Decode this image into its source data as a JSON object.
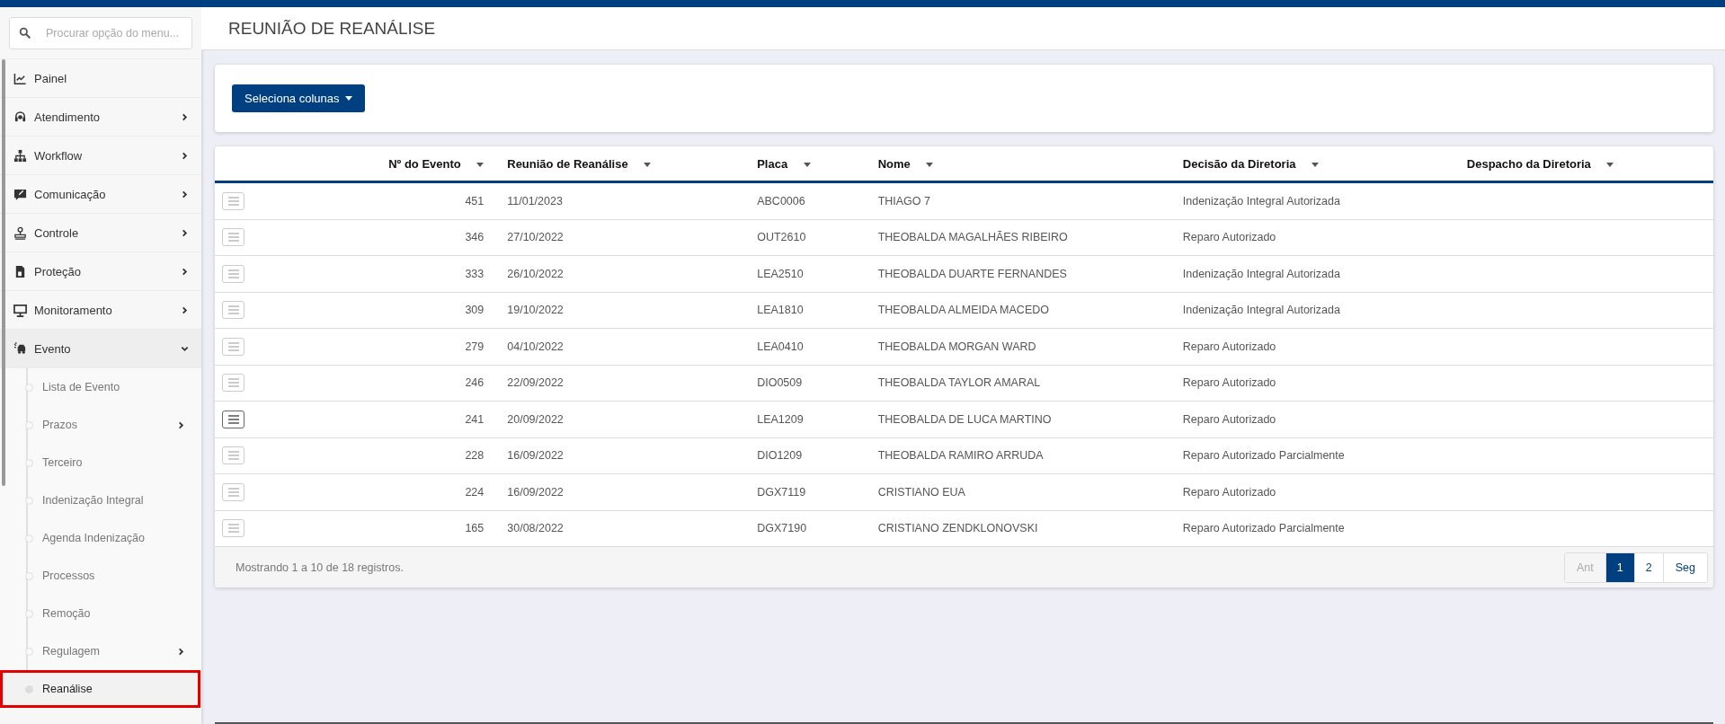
{
  "sidebar": {
    "search": {
      "placeholder": "Procurar opção do menu..."
    },
    "items": [
      {
        "label": "Painel",
        "has_submenu": false,
        "expanded": false
      },
      {
        "label": "Atendimento",
        "has_submenu": true,
        "expanded": false
      },
      {
        "label": "Workflow",
        "has_submenu": true,
        "expanded": false
      },
      {
        "label": "Comunicação",
        "has_submenu": true,
        "expanded": false
      },
      {
        "label": "Controle",
        "has_submenu": true,
        "expanded": false
      },
      {
        "label": "Proteção",
        "has_submenu": true,
        "expanded": false
      },
      {
        "label": "Monitoramento",
        "has_submenu": true,
        "expanded": false
      },
      {
        "label": "Evento",
        "has_submenu": true,
        "expanded": true,
        "children": [
          {
            "label": "Lista de Evento",
            "has_submenu": false,
            "selected": false
          },
          {
            "label": "Prazos",
            "has_submenu": true,
            "selected": false
          },
          {
            "label": "Terceiro",
            "has_submenu": false,
            "selected": false
          },
          {
            "label": "Indenização Integral",
            "has_submenu": false,
            "selected": false
          },
          {
            "label": "Agenda Indenização",
            "has_submenu": false,
            "selected": false
          },
          {
            "label": "Processos",
            "has_submenu": false,
            "selected": false
          },
          {
            "label": "Remoção",
            "has_submenu": false,
            "selected": false
          },
          {
            "label": "Regulagem",
            "has_submenu": true,
            "selected": false
          },
          {
            "label": "Reanálise",
            "has_submenu": false,
            "selected": true
          }
        ]
      }
    ]
  },
  "page": {
    "title": "REUNIÃO DE REANÁLISE"
  },
  "toolbar": {
    "button": "Seleciona colunas"
  },
  "table": {
    "columns": [
      "Nº do Evento",
      "Reunião de Reanálise",
      "Placa",
      "Nome",
      "Decisão da Diretoria",
      "Despacho da Diretoria"
    ],
    "rows": [
      {
        "cells": [
          "451",
          "11/01/2023",
          "ABC0006",
          "THIAGO 7",
          "Indenização Integral Autorizada"
        ],
        "hovered": false
      },
      {
        "cells": [
          "346",
          "27/10/2022",
          "OUT2610",
          "THEOBALDA MAGALHÃES RIBEIRO",
          "Reparo Autorizado"
        ],
        "hovered": false
      },
      {
        "cells": [
          "333",
          "26/10/2022",
          "LEA2510",
          "THEOBALDA DUARTE FERNANDES",
          "Indenização Integral Autorizada"
        ],
        "hovered": false
      },
      {
        "cells": [
          "309",
          "19/10/2022",
          "LEA1810",
          "THEOBALDA ALMEIDA MACEDO",
          "Indenização Integral Autorizada"
        ],
        "hovered": false
      },
      {
        "cells": [
          "279",
          "04/10/2022",
          "LEA0410",
          "THEOBALDA MORGAN WARD",
          "Reparo Autorizado"
        ],
        "hovered": false
      },
      {
        "cells": [
          "246",
          "22/09/2022",
          "DIO0509",
          "THEOBALDA TAYLOR AMARAL",
          "Reparo Autorizado"
        ],
        "hovered": false
      },
      {
        "cells": [
          "241",
          "20/09/2022",
          "LEA1209",
          "THEOBALDA DE LUCA MARTINO",
          "Reparo Autorizado"
        ],
        "hovered": true
      },
      {
        "cells": [
          "228",
          "16/09/2022",
          "DIO1209",
          "THEOBALDA RAMIRO ARRUDA",
          "Reparo Autorizado Parcialmente"
        ],
        "hovered": false
      },
      {
        "cells": [
          "224",
          "16/09/2022",
          "DGX7119",
          "CRISTIANO EUA",
          "Reparo Autorizado"
        ],
        "hovered": false
      },
      {
        "cells": [
          "165",
          "30/08/2022",
          "DGX7190",
          "CRISTIANO ZENDKLONOVSKI",
          "Reparo Autorizado Parcialmente"
        ],
        "hovered": false
      }
    ],
    "info": "Mostrando 1 a 10 de 18 registros.",
    "pagination": [
      {
        "label": "Ant",
        "kind": "prev",
        "selected": false,
        "disabled": true
      },
      {
        "label": "1",
        "kind": "page",
        "selected": true,
        "disabled": false
      },
      {
        "label": "2",
        "kind": "page",
        "selected": false,
        "disabled": false
      },
      {
        "label": "Seg",
        "kind": "next",
        "selected": false,
        "disabled": false
      }
    ]
  }
}
